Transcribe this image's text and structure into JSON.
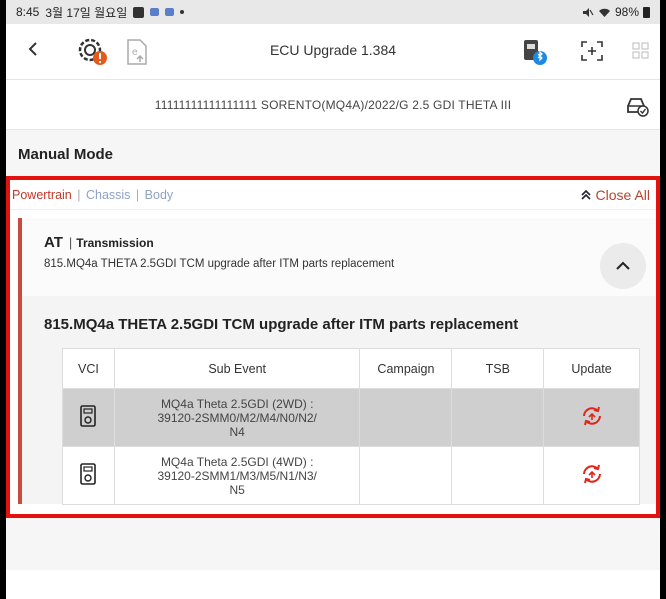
{
  "statusbar": {
    "time": "8:45",
    "date": "3월 17일 월요일",
    "battery": "98%"
  },
  "header": {
    "title": "ECU Upgrade 1.384"
  },
  "vehicle": {
    "info": "11111111111111111  SORENTO(MQ4A)/2022/G 2.5 GDI THETA III"
  },
  "mode": {
    "title": "Manual Mode"
  },
  "filters": {
    "items": [
      "Powertrain",
      "Chassis",
      "Body"
    ],
    "separator": "|",
    "close_all": "Close All"
  },
  "ecu": {
    "name": "AT",
    "separator": "|",
    "system": "Transmission",
    "description": "815.MQ4a THETA 2.5GDI TCM upgrade after ITM parts replacement"
  },
  "event": {
    "title": "815.MQ4a THETA 2.5GDI TCM upgrade after ITM parts replacement",
    "columns": [
      "VCI",
      "Sub Event",
      "Campaign",
      "TSB",
      "Update"
    ],
    "rows": [
      {
        "sub_line1": "MQ4a Theta 2.5GDI (2WD) :",
        "sub_line2": "39120-2SMM0/M2/M4/N0/N2/",
        "sub_line3": "N4",
        "campaign": "",
        "tsb": ""
      },
      {
        "sub_line1": "MQ4a Theta 2.5GDI (4WD) :",
        "sub_line2": "39120-2SMM1/M3/M5/N1/N3/",
        "sub_line3": "N5",
        "campaign": "",
        "tsb": ""
      }
    ]
  },
  "colors": {
    "highlight_border": "#e4120f",
    "accent": "#c0392b",
    "update_icon": "#e0251b"
  },
  "icons": {
    "back": "chevron-left-icon",
    "vehicle_settings": "car-gear-icon",
    "file_upload": "file-upload-icon",
    "vci_bluetooth": "vci-bluetooth-icon",
    "scan": "scan-frame-icon",
    "grid": "grid-icon",
    "car_check": "car-check-icon",
    "collapse": "chevron-up-icon",
    "close_all": "double-chevron-up-icon",
    "vci_device": "vci-device-icon",
    "update": "update-refresh-icon"
  }
}
